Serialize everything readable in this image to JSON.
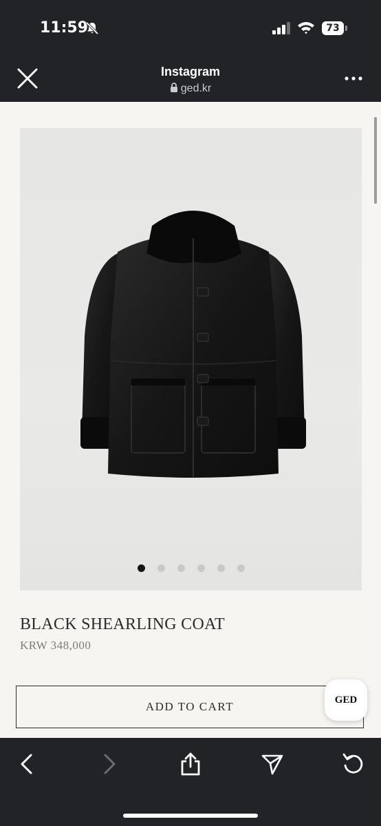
{
  "status_bar": {
    "time": "11:59",
    "battery": "73",
    "icons": [
      "bell-slash-icon",
      "signal-icon",
      "wifi-icon",
      "battery-icon"
    ]
  },
  "browser": {
    "title": "Instagram",
    "url": "ged.kr",
    "close_icon": "close-icon",
    "more_icon": "more-icon"
  },
  "product": {
    "image_alt_icon": "coat-image",
    "carousel": {
      "count": 6,
      "active_index": 0
    },
    "title": "BLACK SHEARLING COAT",
    "price": "KRW 348,000",
    "add_to_cart_label": "ADD TO CART",
    "badge_label": "GED"
  },
  "toolbar": {
    "items": [
      "back-icon",
      "forward-icon",
      "share-icon",
      "send-icon",
      "reload-icon"
    ]
  },
  "colors": {
    "chrome_bg": "#212327",
    "page_bg": "#f7f5f1",
    "image_bg": "#e6e6e4",
    "text_dark": "#2b2b2b",
    "price_gray": "#7c7a76"
  }
}
